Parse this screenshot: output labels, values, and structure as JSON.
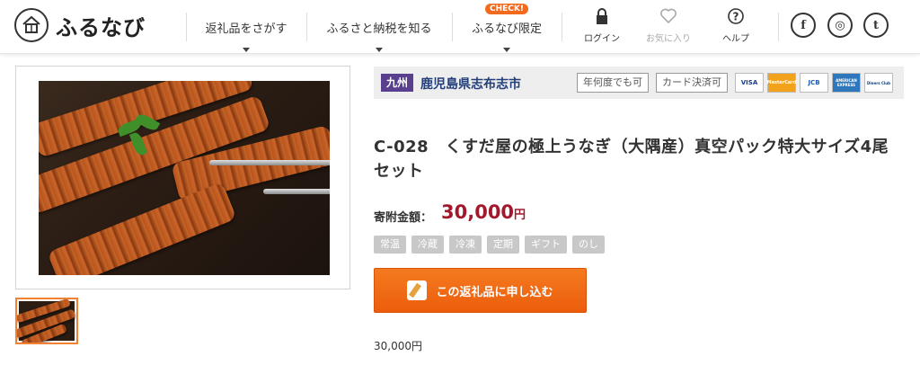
{
  "header": {
    "logo_text": "ふるなび",
    "nav": [
      {
        "label": "返礼品をさがす"
      },
      {
        "label": "ふるさと納税を知る"
      },
      {
        "label": "ふるなび限定",
        "badge": "CHECK!"
      }
    ],
    "utils": {
      "login": "ログイン",
      "favorites": "お気に入り",
      "help": "ヘルプ"
    },
    "social": [
      "f",
      "◎",
      "t"
    ]
  },
  "region": {
    "area": "九州",
    "city": "鹿児島県志布志市",
    "pay_tags": [
      "年何度でも可",
      "カード決済可"
    ],
    "cards": [
      "VISA",
      "MasterCard",
      "JCB",
      "AMERICAN EXPRESS",
      "Diners Club"
    ]
  },
  "product": {
    "title": "C-028　くすだ屋の極上うなぎ（大隅産）真空パック特大サイズ4尾セット",
    "price_label": "寄附金額：",
    "price": "30,000",
    "price_unit": "円",
    "tags": [
      "常温",
      "冷蔵",
      "冷凍",
      "定期",
      "ギフト",
      "のし"
    ],
    "apply_label": "この返礼品に申し込む",
    "bottom_price": "30,000円"
  },
  "colors": {
    "accent_orange": "#f26b1d",
    "price_red": "#a3192c",
    "region_purple": "#5a3f8f",
    "city_blue": "#223e7a"
  }
}
